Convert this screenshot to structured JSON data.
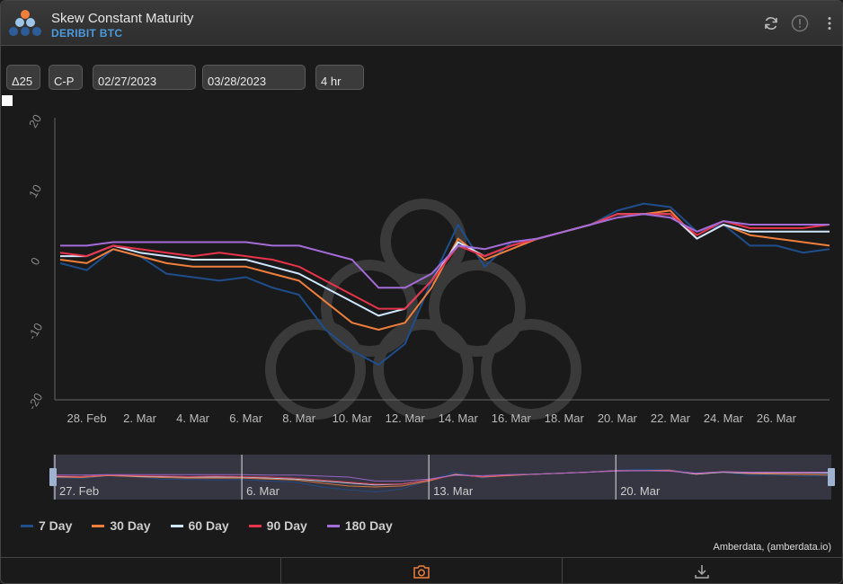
{
  "header": {
    "title": "Skew Constant Maturity",
    "subtitle": "DERIBIT BTC",
    "icons": [
      "refresh-icon",
      "info-icon",
      "more-vert-icon"
    ]
  },
  "controls": {
    "delta": "Δ25",
    "type": "C-P",
    "start_date": "02/27/2023",
    "end_date": "03/28/2023",
    "interval": "4 hr"
  },
  "legend": [
    {
      "name": "7 Day",
      "color": "#1f4e8c"
    },
    {
      "name": "30 Day",
      "color": "#f07f3c"
    },
    {
      "name": "60 Day",
      "color": "#cfe6ff"
    },
    {
      "name": "90 Day",
      "color": "#e8334a"
    },
    {
      "name": "180 Day",
      "color": "#a46cd8"
    }
  ],
  "credit": "Amberdata, (amberdata.io)",
  "footer": {
    "camera_icon": "camera-icon",
    "download_icon": "download-icon"
  },
  "chart_data": {
    "type": "line",
    "x": [
      "2023-02-27",
      "2023-02-28",
      "2023-03-01",
      "2023-03-02",
      "2023-03-03",
      "2023-03-04",
      "2023-03-05",
      "2023-03-06",
      "2023-03-07",
      "2023-03-08",
      "2023-03-09",
      "2023-03-10",
      "2023-03-11",
      "2023-03-12",
      "2023-03-13",
      "2023-03-14",
      "2023-03-15",
      "2023-03-16",
      "2023-03-17",
      "2023-03-18",
      "2023-03-19",
      "2023-03-20",
      "2023-03-21",
      "2023-03-22",
      "2023-03-23",
      "2023-03-24",
      "2023-03-25",
      "2023-03-26",
      "2023-03-27",
      "2023-03-28"
    ],
    "ylim": [
      -20,
      20
    ],
    "yticks": [
      -20,
      -10,
      0,
      10,
      20
    ],
    "xtick_labels": [
      "28. Feb",
      "2. Mar",
      "4. Mar",
      "6. Mar",
      "8. Mar",
      "10. Mar",
      "12. Mar",
      "14. Mar",
      "16. Mar",
      "18. Mar",
      "20. Mar",
      "22. Mar",
      "24. Mar",
      "26. Mar"
    ],
    "navigator_labels": [
      "27. Feb",
      "6. Mar",
      "13. Mar",
      "20. Mar"
    ],
    "grid": false,
    "series": [
      {
        "name": "7 Day",
        "values": [
          -0.5,
          -1.5,
          1.5,
          0.5,
          -2,
          -2.5,
          -3,
          -2.5,
          -4,
          -5,
          -10,
          -13,
          -15,
          -12,
          -3,
          5,
          -1,
          2.5,
          3,
          4,
          5,
          7,
          8,
          7.5,
          4,
          5,
          2,
          2,
          1,
          1.5
        ]
      },
      {
        "name": "30 Day",
        "values": [
          0,
          -0.5,
          1.5,
          0.5,
          -0.5,
          -1,
          -1,
          -1,
          -2,
          -3,
          -6,
          -9,
          -10,
          -9,
          -4,
          3,
          0,
          1.5,
          3,
          4,
          5,
          6.5,
          6.5,
          7,
          3,
          5,
          3.5,
          3,
          2.5,
          2
        ]
      },
      {
        "name": "60 Day",
        "values": [
          0.5,
          0.5,
          2,
          1,
          0.5,
          0,
          0,
          0,
          -1,
          -2,
          -4,
          -6,
          -8,
          -7,
          -3,
          2.5,
          0.5,
          2,
          3,
          4,
          5,
          6.5,
          6.5,
          6.5,
          3,
          5,
          4,
          4,
          4,
          4
        ]
      },
      {
        "name": "90 Day",
        "values": [
          1,
          0.5,
          2,
          1.5,
          1,
          0.5,
          1,
          0.5,
          0,
          -1,
          -3,
          -5,
          -7,
          -7,
          -3,
          2,
          0.5,
          2,
          3,
          4,
          5,
          6.5,
          6.5,
          6.5,
          3.5,
          5.5,
          4.5,
          4.5,
          4.5,
          5
        ]
      },
      {
        "name": "180 Day",
        "values": [
          2,
          2,
          2.5,
          2.5,
          2.5,
          2.5,
          2.5,
          2.5,
          2,
          2,
          1,
          0,
          -4,
          -4,
          -2,
          2,
          1.5,
          2.5,
          3,
          4,
          5,
          6,
          6.5,
          6,
          4,
          5.5,
          5,
          5,
          5,
          5
        ]
      }
    ]
  }
}
